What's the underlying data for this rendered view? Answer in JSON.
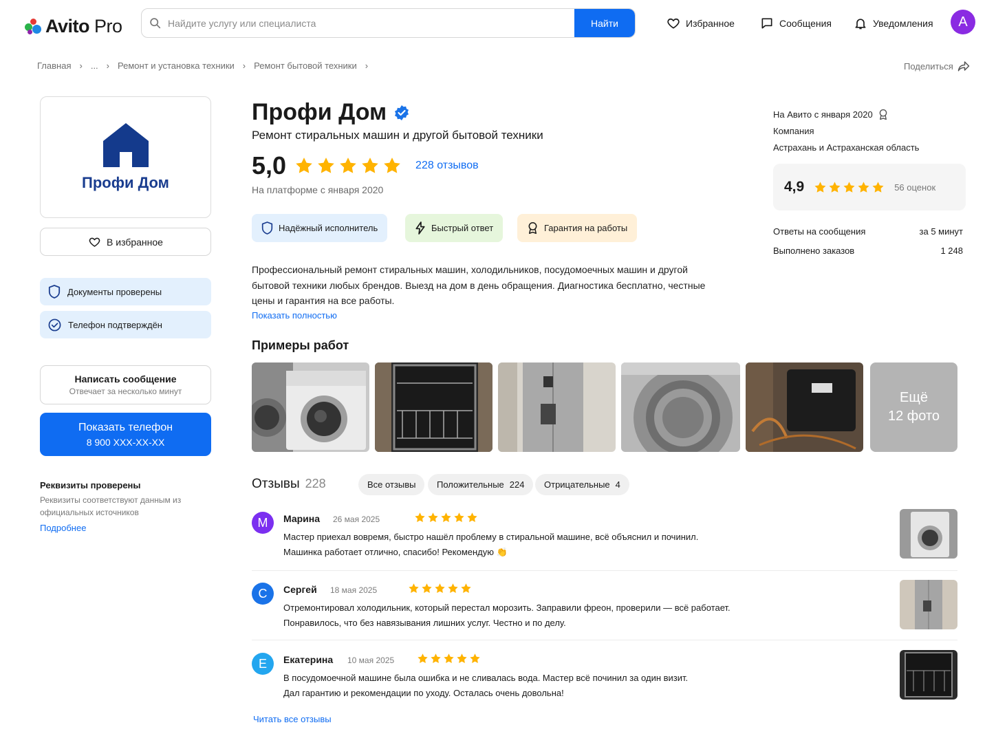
{
  "header": {
    "logo_brand": "Avito",
    "logo_suffix": "Pro",
    "search_placeholder": "Найдите услугу или специалиста",
    "search_button": "Найти",
    "nav": {
      "favorites": "Избранное",
      "messages": "Сообщения",
      "notifications": "Уведомления"
    },
    "avatar_letter": "А",
    "colors": {
      "accent": "#0f6cf2",
      "avatar": "#8a2be2"
    }
  },
  "breadcrumbs": {
    "items": [
      "Главная",
      "...",
      "Ремонт и установка техники",
      "Ремонт бытовой техники"
    ],
    "share": "Поделиться"
  },
  "left": {
    "logo_name": "Профи Дом",
    "favorite_button": "В избранное",
    "verifications": [
      "Документы проверены",
      "Телефон подтверждён"
    ],
    "message_button": {
      "title": "Написать сообщение",
      "subtitle": "Отвечает за несколько минут"
    },
    "phone_button": {
      "title": "Показать телефон",
      "number": "8 900 XXX-XX-XX"
    },
    "requisites": {
      "title": "Реквизиты проверены",
      "text": "Реквизиты соответствуют данным из официальных источников",
      "link": "Подробнее"
    }
  },
  "profile": {
    "name": "Профи Дом",
    "subtitle": "Ремонт стиральных машин и другой бытовой техники",
    "rating": "5,0",
    "stars": 5,
    "reviews_link": "228 отзывов",
    "platform_since": "На платформе с января 2020",
    "badges": [
      "Надёжный исполнитель",
      "Быстрый ответ",
      "Гарантия на работы"
    ],
    "badge_colors": [
      "#e3f0fd",
      "#e6f6dc",
      "#fff0d8"
    ],
    "description": "Профессиональный ремонт стиральных машин, холодильников, посудомоечных машин и другой бытовой техники любых брендов. Выезд на дом в день обращения. Диагностика бесплатно, честные цены и гарантия на все работы.",
    "show_full": "Показать полностью"
  },
  "works": {
    "title": "Примеры работ",
    "more_line1": "Ещё",
    "more_line2": "12 фото"
  },
  "reviews": {
    "title": "Отзывы",
    "count": "228",
    "filters": [
      {
        "label": "Все отзывы",
        "count": ""
      },
      {
        "label": "Положительные",
        "count": "224"
      },
      {
        "label": "Отрицательные",
        "count": "4"
      }
    ],
    "items": [
      {
        "initial": "М",
        "color": "#7b2ff0",
        "name": "Марина",
        "date": "26 мая 2025",
        "stars": 5,
        "line1": "Мастер приехал вовремя, быстро нашёл проблему в стиральной машине, всё объяснил и починил.",
        "line2": "Машинка работает отлично, спасибо! Рекомендую 👏"
      },
      {
        "initial": "С",
        "color": "#1a73e8",
        "name": "Сергей",
        "date": "18 мая 2025",
        "stars": 5,
        "line1": "Отремонтировал холодильник, который перестал морозить. Заправили фреон, проверили — всё работает.",
        "line2": "Понравилось, что без навязывания лишних услуг. Честно и по делу."
      },
      {
        "initial": "Е",
        "color": "#23a6ef",
        "name": "Екатерина",
        "date": "10 мая 2025",
        "stars": 5,
        "line1": "В посудомоечной машине была ошибка и не сливалась вода. Мастер всё починил за один визит.",
        "line2": "Дал гарантию и рекомендации по уходу. Осталась очень довольна!"
      }
    ],
    "read_all": "Читать все отзывы"
  },
  "right": {
    "since": "На Авито с января 2020",
    "type": "Компания",
    "region": "Астрахань и Астраханская область",
    "rating": "4,9",
    "rating_count": "56 оценок",
    "stats": [
      {
        "label": "Ответы на сообщения",
        "value": "за 5 минут"
      },
      {
        "label": "Выполнено заказов",
        "value": "1 248"
      }
    ]
  },
  "icons": [
    "search-icon",
    "heart-icon",
    "chat-icon",
    "bell-icon",
    "share-icon",
    "verified-icon",
    "shield-icon",
    "check-circle-icon",
    "lightning-icon",
    "award-icon",
    "star-icon",
    "house-icon"
  ],
  "star_color": "#ffb300"
}
